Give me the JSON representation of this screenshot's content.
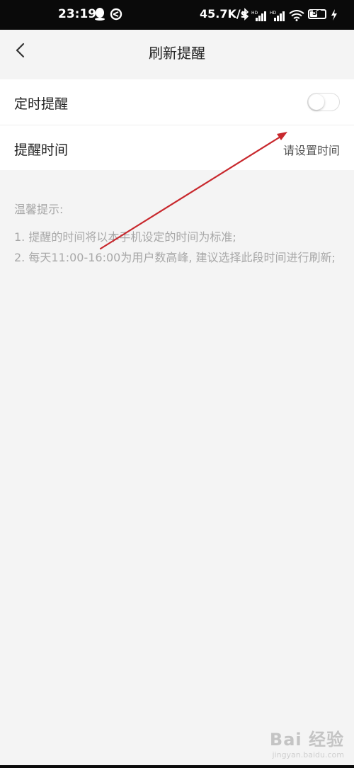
{
  "status_bar": {
    "time": "23:19",
    "network_speed": "45.7K/s",
    "battery_level": "50",
    "battery_fraction": 0.5,
    "icons": [
      "qq-icon",
      "sync-icon",
      "bluetooth-icon",
      "hd-signal-icon",
      "hd-signal-icon",
      "wifi-icon",
      "battery-icon",
      "charging-icon"
    ]
  },
  "header": {
    "title": "刷新提醒",
    "back_icon": "chevron-left-icon"
  },
  "settings": {
    "timed_reminder_label": "定时提醒",
    "timed_reminder_enabled": false,
    "reminder_time_label": "提醒时间",
    "reminder_time_value": "请设置时间"
  },
  "tips": {
    "title": "温馨提示:",
    "line1": "1. 提醒的时间将以本手机设定的时间为标准;",
    "line2": "2. 每天11:00-16:00为用户数高峰, 建议选择此段时间进行刷新;"
  },
  "watermark": {
    "brand": "Bai 经验",
    "url": "jingyan.baidu.com"
  },
  "colors": {
    "background": "#f4f4f4",
    "card": "#ffffff",
    "annotation_arrow": "#c8282d",
    "tip_text": "#a8a8a8"
  }
}
